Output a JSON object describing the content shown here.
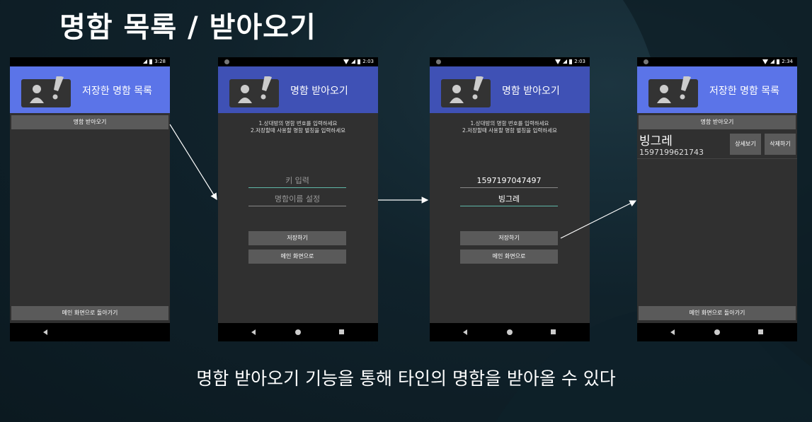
{
  "slide": {
    "title": "명함 목록 / 받아오기",
    "caption": "명함 받아오기 기능을 통해 타인의 명함을 받아올 수 있다"
  },
  "colors": {
    "appbar_light": "#5b74e8",
    "appbar_dark": "#3f51b5",
    "field_accent": "#5fb8a8",
    "button": "#5a5a5a",
    "screen_bg": "#303030"
  },
  "phones": [
    {
      "time": "3:28",
      "app_title": "저장한 명함 목록",
      "top_button": "명함 받아오기",
      "bottom_button": "메인 화면으로 돌아가기"
    },
    {
      "time": "2:03",
      "app_title": "명함 받아오기",
      "instruction_1": "1.상대방의 명함 번호를 입력하세요",
      "instruction_2": "2.저장할때 사용할 명함 별칭을 입력하세요",
      "key_placeholder": "키 입력",
      "name_placeholder": "명함이름 설정",
      "save_button": "저장하기",
      "main_button": "메인 화면으로"
    },
    {
      "time": "2:03",
      "app_title": "명함 받아오기",
      "instruction_1": "1.상대방의 명함 번호를 입력하세요",
      "instruction_2": "2.저장할때 사용할 명함 별칭을 입력하세요",
      "key_value": "1597197047497",
      "name_value": "빙그레",
      "save_button": "저장하기",
      "main_button": "메인 화면으로"
    },
    {
      "time": "2:34",
      "app_title": "저장한 명함 목록",
      "top_button": "명함 받아오기",
      "card_name": "빙그레",
      "card_key": "1597199621743",
      "detail_button": "상세보기",
      "delete_button": "삭제하기",
      "bottom_button": "메인 화면으로 돌아가기"
    }
  ]
}
